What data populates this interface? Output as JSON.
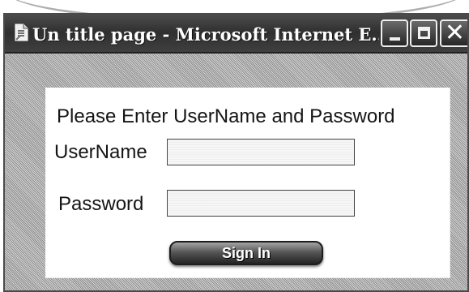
{
  "window": {
    "title": "Un title page - Microsoft Internet E...",
    "icon": "document-icon",
    "controls": {
      "minimize": "minimize-icon",
      "maximize": "maximize-icon",
      "close_icon": "close-icon",
      "close_glyph": "✕"
    }
  },
  "login_form": {
    "heading": "Please Enter UserName and Password",
    "username": {
      "label": "UserName",
      "value": "",
      "placeholder": ""
    },
    "password": {
      "label": "Password",
      "value": "",
      "placeholder": ""
    },
    "submit_label": "Sign In"
  }
}
